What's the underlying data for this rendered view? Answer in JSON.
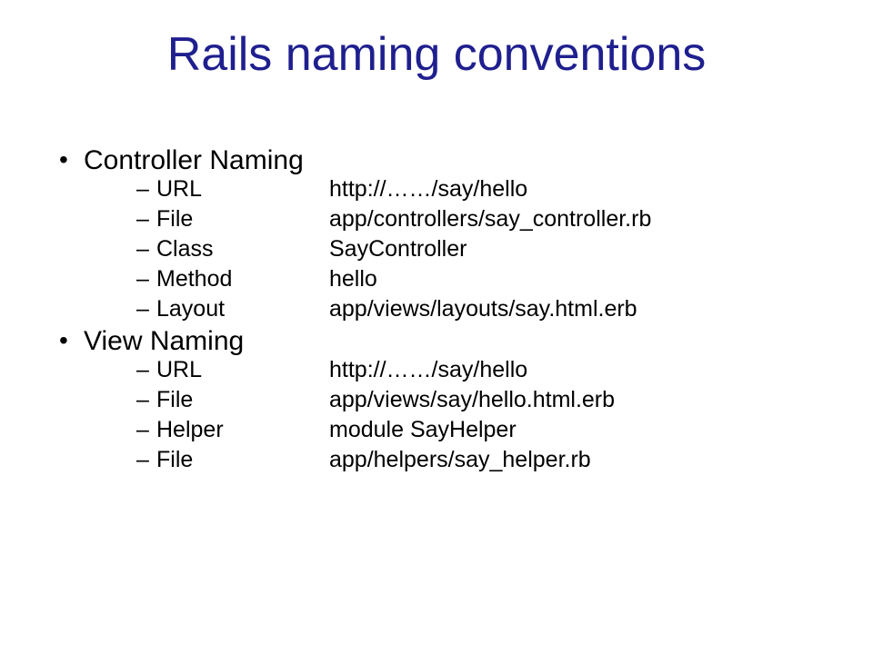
{
  "title": "Rails naming conventions",
  "sections": [
    {
      "heading": "Controller Naming",
      "items": [
        {
          "label": "URL",
          "value": "http://……/say/hello"
        },
        {
          "label": "File",
          "value": "app/controllers/say_controller.rb"
        },
        {
          "label": "Class",
          "value": "SayController"
        },
        {
          "label": "Method",
          "value": "hello"
        },
        {
          "label": "Layout",
          "value": "app/views/layouts/say.html.erb"
        }
      ]
    },
    {
      "heading": "View Naming",
      "items": [
        {
          "label": "URL",
          "value": "http://……/say/hello"
        },
        {
          "label": "File",
          "value": "app/views/say/hello.html.erb"
        },
        {
          "label": "Helper",
          "value": "module SayHelper"
        },
        {
          "label": "File",
          "value": "app/helpers/say_helper.rb"
        }
      ]
    }
  ]
}
